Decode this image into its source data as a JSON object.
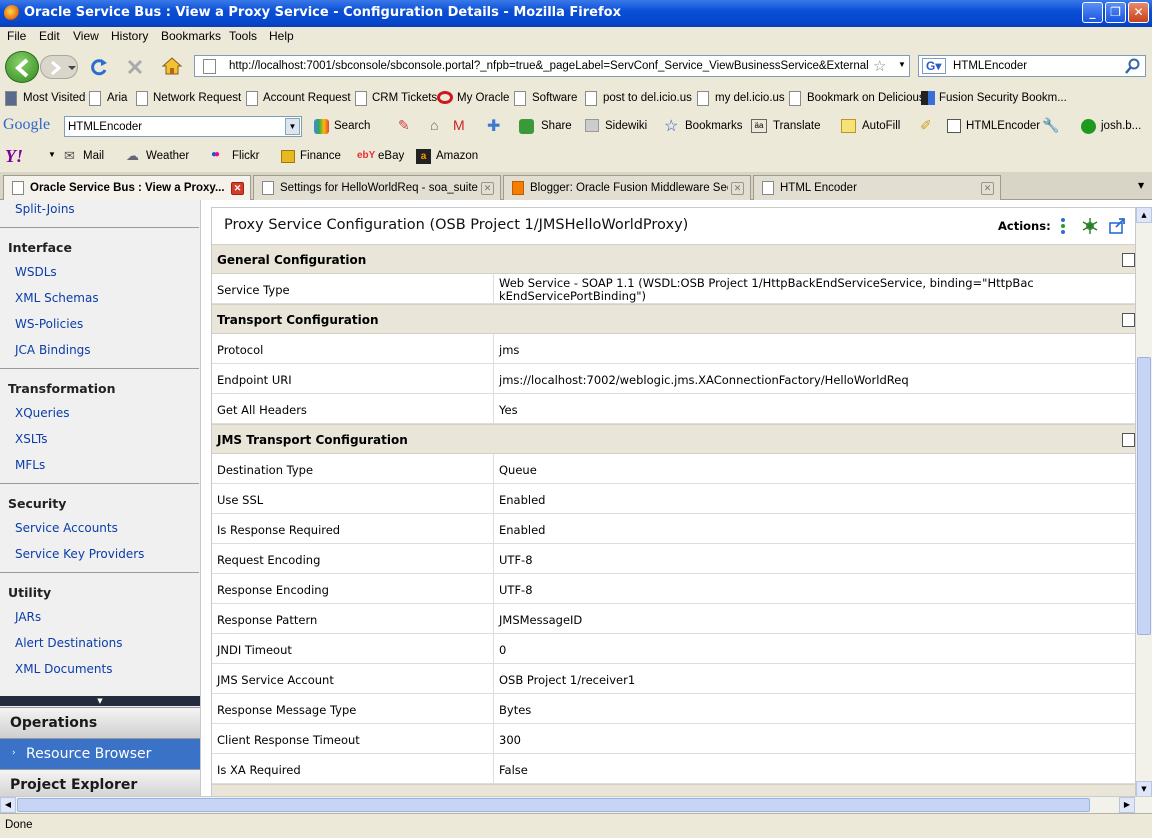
{
  "window": {
    "title": "Oracle Service Bus : View a Proxy Service - Configuration Details - Mozilla Firefox"
  },
  "menu": [
    "File",
    "Edit",
    "View",
    "History",
    "Bookmarks",
    "Tools",
    "Help"
  ],
  "nav": {
    "url": "http://localhost:7001/sbconsole/sbconsole.portal?_nfpb=true&_pageLabel=ServConf_Service_ViewBusinessService&ExternalService",
    "search_value": "HTMLEncoder"
  },
  "bookmarks": [
    "Most Visited",
    "Aria",
    "Network Request",
    "Account Request",
    "CRM Tickets",
    "My Oracle",
    "Software",
    "post to del.icio.us",
    "my del.icio.us",
    "Bookmark on Delicious",
    "Fusion Security Bookm..."
  ],
  "google_toolbar": {
    "logo": "Google",
    "query": "HTMLEncoder",
    "items": [
      "Search",
      "Share",
      "Sidewiki",
      "Bookmarks",
      "Translate",
      "AutoFill",
      "HTMLEncoder",
      "josh.b..."
    ]
  },
  "yahoo_toolbar": {
    "logo": "Y!",
    "items": [
      "Mail",
      "Weather",
      "Flickr",
      "Finance",
      "eBay",
      "Amazon"
    ]
  },
  "tabs": [
    {
      "label": "Oracle Service Bus : View a Proxy..."
    },
    {
      "label": "Settings for HelloWorldReq - soa_suite..."
    },
    {
      "label": "Blogger: Oracle Fusion Middleware Sec..."
    },
    {
      "label": "HTML Encoder"
    }
  ],
  "sidebar": {
    "top_link": "Split-Joins",
    "groups": [
      {
        "title": "Interface",
        "items": [
          "WSDLs",
          "XML Schemas",
          "WS-Policies",
          "JCA Bindings"
        ]
      },
      {
        "title": "Transformation",
        "items": [
          "XQueries",
          "XSLTs",
          "MFLs"
        ]
      },
      {
        "title": "Security",
        "items": [
          "Service Accounts",
          "Service Key Providers"
        ]
      },
      {
        "title": "Utility",
        "items": [
          "JARs",
          "Alert Destinations",
          "XML Documents"
        ]
      }
    ],
    "accordion": [
      "Operations",
      "Resource Browser",
      "Project Explorer"
    ]
  },
  "main": {
    "title": "Proxy Service Configuration (OSB Project 1/JMSHelloWorldProxy)",
    "actions_label": "Actions:",
    "sections": [
      {
        "title": "General Configuration",
        "rows": [
          {
            "k": "Service Type",
            "v1": "Web Service - SOAP 1.1 (WSDL:OSB Project 1/HttpBackEndServiceService, binding=\"HttpBac",
            "v2": "kEndServicePortBinding\")"
          }
        ]
      },
      {
        "title": "Transport Configuration",
        "rows": [
          {
            "k": "Protocol",
            "v": "jms"
          },
          {
            "k": "Endpoint URI",
            "v": "jms://localhost:7002/weblogic.jms.XAConnectionFactory/HelloWorldReq"
          },
          {
            "k": "Get All Headers",
            "v": "Yes"
          }
        ]
      },
      {
        "title": "JMS Transport Configuration",
        "rows": [
          {
            "k": "Destination Type",
            "v": "Queue"
          },
          {
            "k": "Use SSL",
            "v": "Enabled"
          },
          {
            "k": "Is Response Required",
            "v": "Enabled"
          },
          {
            "k": "Request Encoding",
            "v": "UTF-8"
          },
          {
            "k": "Response Encoding",
            "v": "UTF-8"
          },
          {
            "k": "Response Pattern",
            "v": "JMSMessageID"
          },
          {
            "k": "JNDI Timeout",
            "v": "0"
          },
          {
            "k": "JMS Service Account",
            "v": "OSB Project 1/receiver1"
          },
          {
            "k": "Response Message Type",
            "v": "Bytes"
          },
          {
            "k": "Client Response Timeout",
            "v": "300"
          },
          {
            "k": "Is XA Required",
            "v": "False"
          }
        ]
      }
    ]
  },
  "status": "Done"
}
